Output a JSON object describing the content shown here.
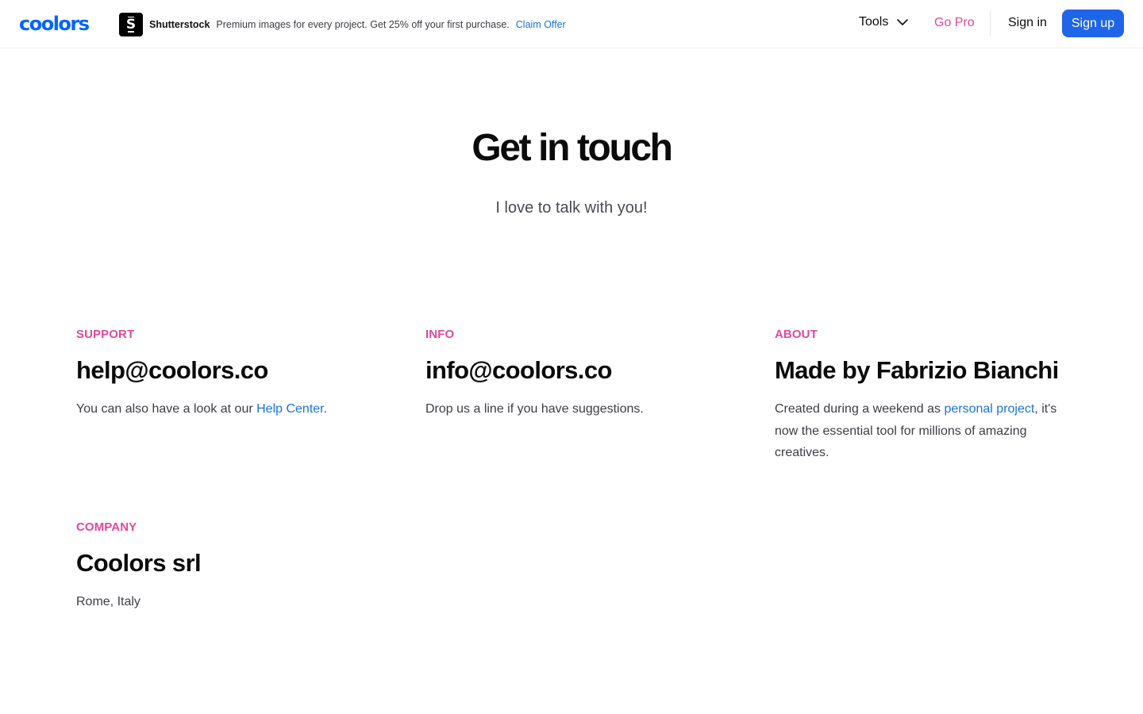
{
  "header": {
    "logo_text": "coolors",
    "ad": {
      "icon": "shutterstock-logo-icon",
      "brand": "Shutterstock",
      "text": "Premium images for every project. Get 25% off your first purchase.",
      "link": "Claim Offer"
    },
    "nav": {
      "tools_label": "Tools",
      "tools_icon": "chevron-down-icon",
      "gopro_label": "Go Pro",
      "signin_label": "Sign in",
      "signup_label": "Sign up"
    }
  },
  "hero": {
    "title": "Get in touch",
    "subtitle": "I love to talk with you!"
  },
  "sections": {
    "support": {
      "eyebrow": "SUPPORT",
      "headline": "help@coolors.co",
      "desc_before": "You can also have a look at our ",
      "desc_link": "Help Center",
      "desc_after": "."
    },
    "info": {
      "eyebrow": "INFO",
      "headline": "info@coolors.co",
      "desc": "Drop us a line if you have suggestions."
    },
    "about": {
      "eyebrow": "ABOUT",
      "headline": "Made by Fabrizio Bianchi",
      "desc_before": "Created during a weekend as ",
      "desc_link": "personal project",
      "desc_after": ", it's now the essential tool for millions of amazing creatives."
    },
    "company": {
      "eyebrow": "COMPANY",
      "headline": "Coolors srl",
      "desc": "Rome, Italy"
    }
  },
  "colors": {
    "brand_blue": "#0066ff",
    "accent_pink": "#e0489a",
    "button_blue": "#1f65e8",
    "link_blue": "#1a73d9"
  }
}
